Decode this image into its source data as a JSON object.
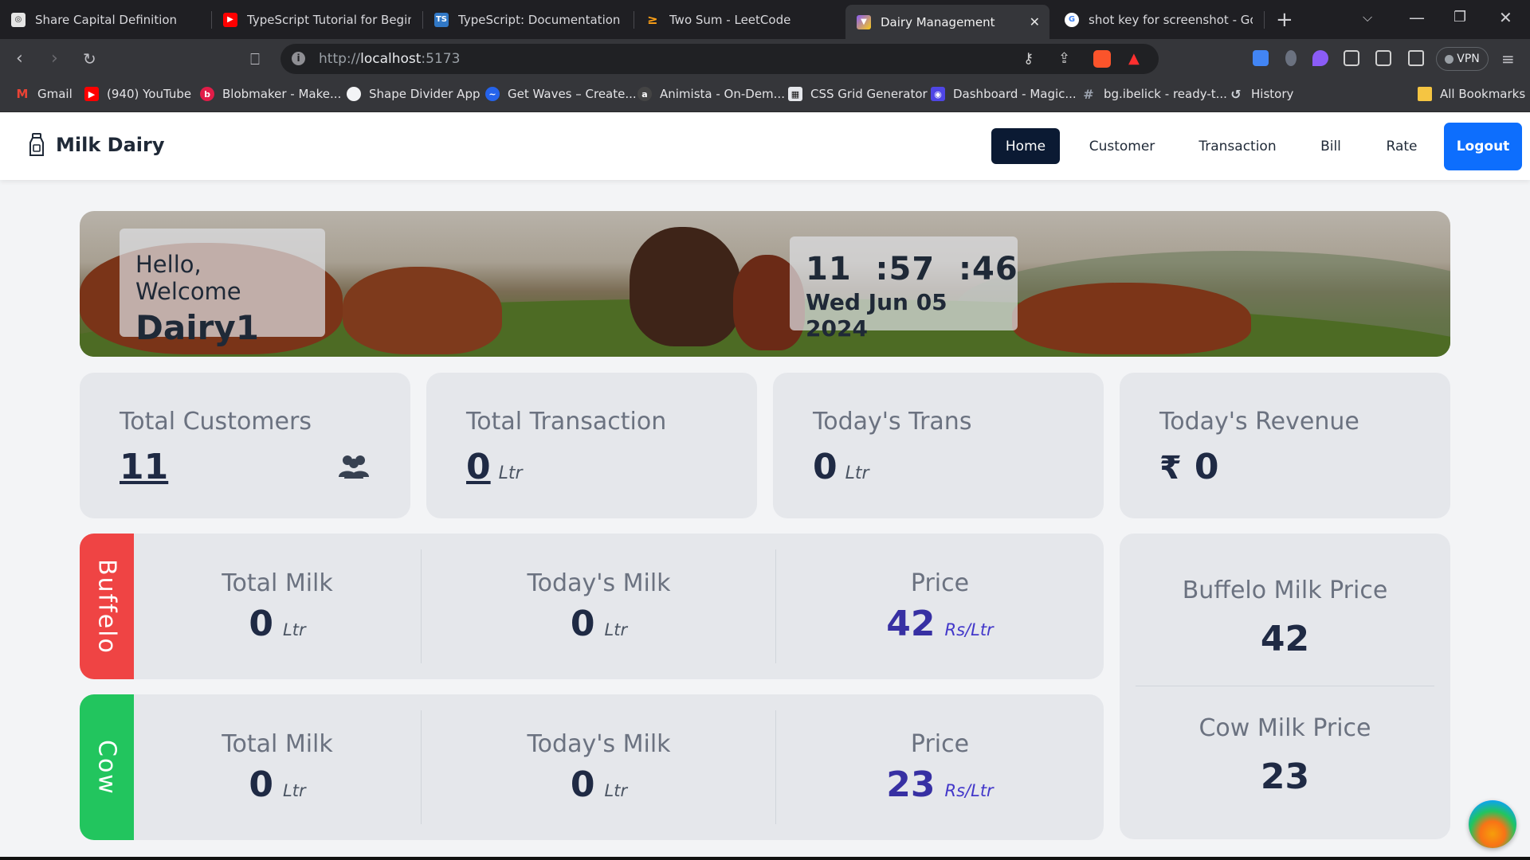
{
  "browser": {
    "tabs": [
      {
        "title": "Share Capital Definition",
        "color": "#3c3c3c",
        "glyph": "◎"
      },
      {
        "title": "TypeScript Tutorial for Beginner",
        "color": "#ff0000",
        "glyph": "▶"
      },
      {
        "title": "TypeScript: Documentation - Ty",
        "color": "#3178c6",
        "glyph": "TS"
      },
      {
        "title": "Two Sum - LeetCode",
        "color": "#ffa116",
        "glyph": "≥"
      },
      {
        "title": "Dairy Management",
        "color": "#8b5cf6",
        "glyph": "▼",
        "active": true
      },
      {
        "title": "shot key for screenshot - Goog",
        "color": "#4285f4",
        "glyph": "G"
      }
    ],
    "new_tab_label": "+",
    "close_label": "✕",
    "url_prefix": "http://",
    "url_host": "localhost",
    "url_port": ":5173",
    "vpn_label": "VPN",
    "bookmarks": [
      {
        "label": "Gmail",
        "color": "#ea4335",
        "glyph": "M"
      },
      {
        "label": "(940) YouTube",
        "color": "#ff0000",
        "glyph": "▶"
      },
      {
        "label": "Blobmaker - Make...",
        "color": "#e11d48",
        "glyph": "b"
      },
      {
        "label": "Shape Divider App",
        "color": "#f3f4f6",
        "glyph": "◐"
      },
      {
        "label": "Get Waves – Create...",
        "color": "#2563eb",
        "glyph": "~"
      },
      {
        "label": "Animista - On-Dem...",
        "color": "#444444",
        "glyph": "a"
      },
      {
        "label": "CSS Grid Generator",
        "color": "#e5e7eb",
        "glyph": "▦"
      },
      {
        "label": "Dashboard - Magic...",
        "color": "#4f46e5",
        "glyph": "◉"
      },
      {
        "label": "bg.ibelick - ready-t...",
        "color": "#6b7280",
        "glyph": "#"
      },
      {
        "label": "History",
        "color": "#6b7280",
        "glyph": "↺"
      }
    ],
    "all_bookmarks_label": "All Bookmarks"
  },
  "app": {
    "brand": "Milk Dairy",
    "nav": {
      "home": "Home",
      "customer": "Customer",
      "transaction": "Transaction",
      "bill": "Bill",
      "rate": "Rate",
      "logout": "Logout"
    },
    "hero": {
      "greeting": "Hello, Welcome",
      "username": "Dairy1",
      "time": "11  :57  :46",
      "date": "Wed Jun 05 2024"
    },
    "stats": {
      "total_customers": {
        "label": "Total Customers",
        "value": "11"
      },
      "total_transaction": {
        "label": "Total Transaction",
        "value": "0",
        "unit": "Ltr"
      },
      "todays_trans": {
        "label": "Today's Trans",
        "value": "0",
        "unit": "Ltr"
      },
      "todays_revenue": {
        "label": "Today's Revenue",
        "currency": "₹",
        "value": "0"
      }
    },
    "buffalo": {
      "tag": "Buffelo",
      "total_milk": {
        "label": "Total Milk",
        "value": "0",
        "unit": "Ltr"
      },
      "todays_milk": {
        "label": "Today's Milk",
        "value": "0",
        "unit": "Ltr"
      },
      "price": {
        "label": "Price",
        "value": "42",
        "unit": "Rs/Ltr"
      }
    },
    "cow": {
      "tag": "Cow",
      "total_milk": {
        "label": "Total Milk",
        "value": "0",
        "unit": "Ltr"
      },
      "todays_milk": {
        "label": "Today's Milk",
        "value": "0",
        "unit": "Ltr"
      },
      "price": {
        "label": "Price",
        "value": "23",
        "unit": "Rs/Ltr"
      }
    },
    "prices": {
      "buffalo_label": "Buffelo Milk Price",
      "buffalo_value": "42",
      "cow_label": "Cow Milk Price",
      "cow_value": "23"
    },
    "colors": {
      "nav_active": "#0b1a33",
      "logout": "#0d6efd",
      "buffalo_tag": "#ef4444",
      "cow_tag": "#22c55e",
      "price_text": "#3730a3"
    }
  }
}
